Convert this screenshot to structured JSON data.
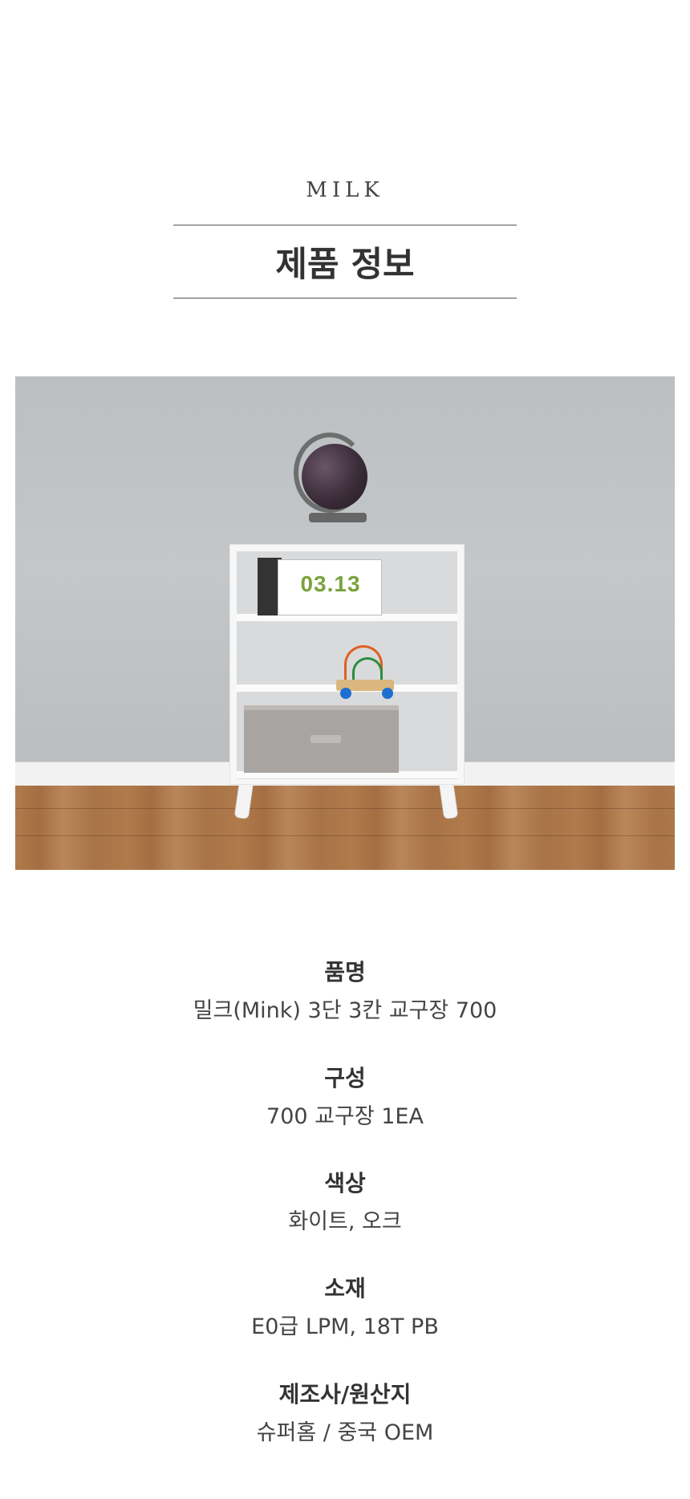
{
  "header": {
    "brand": "MILK",
    "title": "제품 정보"
  },
  "calendar_date": "03.13",
  "specs": [
    {
      "label": "품명",
      "value": "밀크(Mink) 3단 3칸 교구장 700"
    },
    {
      "label": "구성",
      "value": "700 교구장  1EA"
    },
    {
      "label": "색상",
      "value": "화이트, 오크"
    },
    {
      "label": "소재",
      "value": "E0급 LPM, 18T PB"
    },
    {
      "label": "제조사/원산지",
      "value": "슈퍼홈  / 중국 OEM"
    }
  ]
}
